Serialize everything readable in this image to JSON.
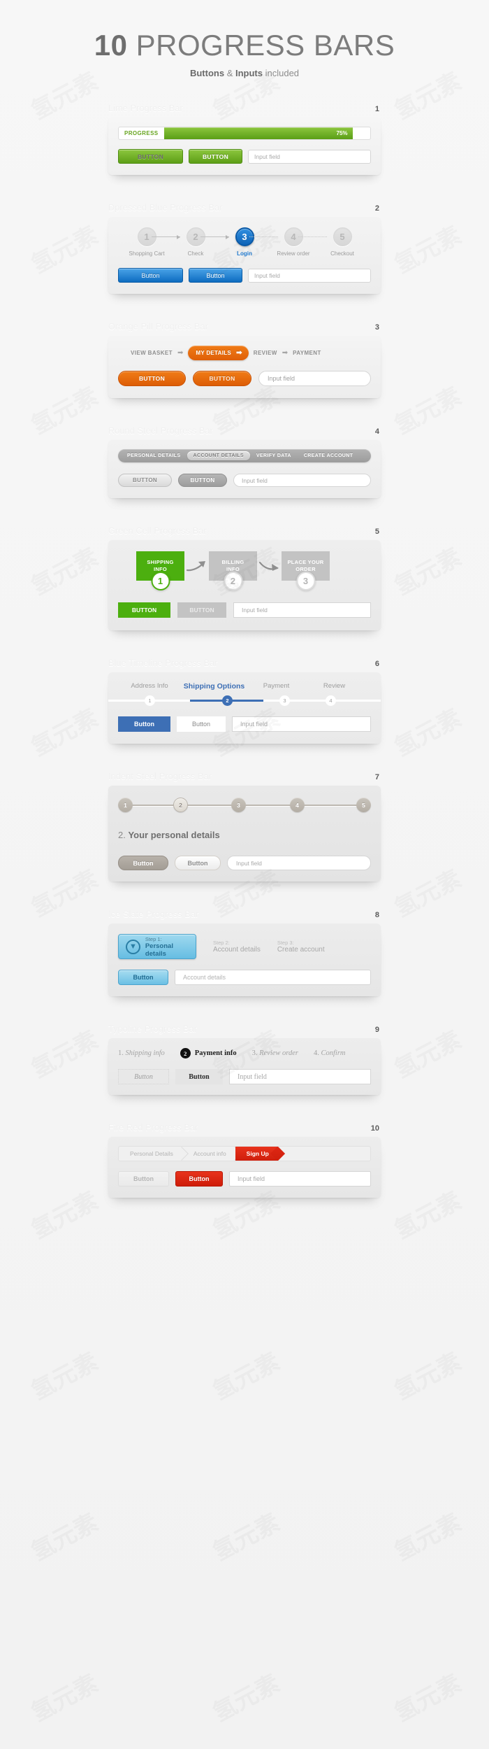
{
  "header": {
    "title_number": "10",
    "title_rest": "PROGRESS BARS",
    "sub_a": "Buttons",
    "sub_amp": " & ",
    "sub_b": "Inputs",
    "sub_c": " included"
  },
  "common": {
    "input_placeholder": "Input field"
  },
  "sections": [
    {
      "num": "1",
      "title": "Lime Progress Bar",
      "progress_label": "PROGRESS",
      "progress_value": "75%",
      "progress_percent": 75,
      "btn1": "BUTTON",
      "btn2": "BUTTON",
      "input": "Input field",
      "accent": "#6aa81e"
    },
    {
      "num": "2",
      "title": "Dpressed Blue Progress Bar",
      "steps": [
        {
          "num": "1",
          "label": "Shopping Cart",
          "active": false
        },
        {
          "num": "2",
          "label": "Check",
          "active": false
        },
        {
          "num": "3",
          "label": "Login",
          "active": true
        },
        {
          "num": "4",
          "label": "Review order",
          "active": false
        },
        {
          "num": "5",
          "label": "Checkout",
          "active": false
        }
      ],
      "btn1": "Button",
      "btn2": "Button",
      "input": "Input field",
      "accent": "#0d63b8"
    },
    {
      "num": "3",
      "title": "Orange Pill Progress Bar",
      "steps": [
        {
          "label": "VIEW BASKET",
          "active": false
        },
        {
          "label": "MY DETAILS",
          "active": true
        },
        {
          "label": "REVIEW",
          "active": false
        },
        {
          "label": "PAYMENT",
          "active": false
        }
      ],
      "btn1": "BUTTON",
      "btn2": "BUTTON",
      "input": "Input field",
      "accent": "#e06509"
    },
    {
      "num": "4",
      "title": "Round Steel Progress Bar",
      "steps": [
        {
          "label": "PERSONAL DETAILS",
          "active": false
        },
        {
          "label": "ACCOUNT DETAILS",
          "active": true
        },
        {
          "label": "VERIFY DATA",
          "active": false
        },
        {
          "label": "CREATE ACCOUNT",
          "active": false
        }
      ],
      "btn1": "BUTTON",
      "btn2": "BUTTON",
      "input": "Input field",
      "accent": "#9c9c9c"
    },
    {
      "num": "5",
      "title": "Green Cell Progress Bar",
      "cells": [
        {
          "line1": "SHIPPING",
          "line2": "INFO",
          "num": "1",
          "active": true
        },
        {
          "line1": "BILLING",
          "line2": "INFO",
          "num": "2",
          "active": false
        },
        {
          "line1": "PLACE YOUR",
          "line2": "ORDER",
          "num": "3",
          "active": false
        }
      ],
      "btn1": "BUTTON",
      "btn2": "BUTTON",
      "input": "Input field",
      "accent": "#4caf0f"
    },
    {
      "num": "6",
      "title": "Blue Timeline Progress Bar",
      "steps": [
        {
          "num": "1",
          "label": "Address Info",
          "active": false
        },
        {
          "num": "2",
          "label": "Shipping Options",
          "active": true
        },
        {
          "num": "3",
          "label": "Payment",
          "active": false
        },
        {
          "num": "4",
          "label": "Review",
          "active": false
        }
      ],
      "btn1": "Button",
      "btn2": "Button",
      "input": "Input field",
      "accent": "#3d6fb5"
    },
    {
      "num": "7",
      "title": "Indent Steel Progress Bar",
      "steps": [
        {
          "num": "1",
          "active": false
        },
        {
          "num": "2",
          "active": true
        },
        {
          "num": "3",
          "active": false
        },
        {
          "num": "4",
          "active": false
        },
        {
          "num": "5",
          "active": false
        }
      ],
      "heading_num": "2. ",
      "heading_text": "Your personal details",
      "btn1": "Button",
      "btn2": "Button",
      "input": "Input field",
      "accent": "#b3ada4"
    },
    {
      "num": "8",
      "title": "Ice Slate Progress Bar",
      "active_step_small": "Step 1:",
      "active_step_main": "Personal details",
      "active_icon": "download-arrow-icon",
      "steps": [
        {
          "small": "Step 2:",
          "main": "Account details"
        },
        {
          "small": "Step 3:",
          "main": "Create account"
        }
      ],
      "btn1": "Button",
      "input": "Account details",
      "accent": "#66bde2"
    },
    {
      "num": "9",
      "title": "Typoline Progress Bar",
      "steps": [
        {
          "num": "1.",
          "label": "Shipping info",
          "active": false
        },
        {
          "num": "2",
          "label": "Payment info",
          "active": true
        },
        {
          "num": "3.",
          "label": "Review order",
          "active": false
        },
        {
          "num": "4.",
          "label": "Confirm",
          "active": false
        }
      ],
      "btn1": "Button",
      "btn2": "Button",
      "input": "Input field",
      "accent": "#111111"
    },
    {
      "num": "10",
      "title": "Fire Red Progress Bar",
      "steps": [
        {
          "label": "Personal Details",
          "active": false
        },
        {
          "label": "Account info",
          "active": false
        },
        {
          "label": "Sign Up",
          "active": true
        }
      ],
      "btn1": "Button",
      "btn2": "Button",
      "input": "Input field",
      "accent": "#d52310"
    }
  ]
}
